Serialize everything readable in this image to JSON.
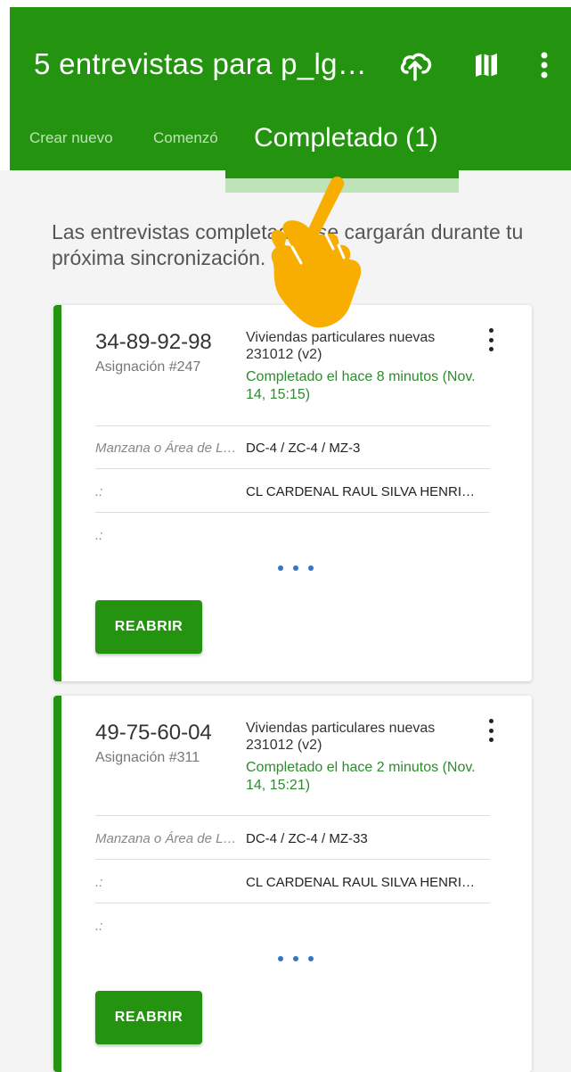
{
  "app_bar": {
    "title": "5 entrevistas para p_lg…",
    "icons": [
      "cloud-sync-icon",
      "map-icon",
      "more-vert-icon"
    ],
    "color": "#24930f"
  },
  "tabs": [
    {
      "label": "Crear nuevo",
      "active": false
    },
    {
      "label": "Comenzó",
      "active": false
    },
    {
      "label": "Completado (1)",
      "active": true
    }
  ],
  "info_text": "Las entrevistas completadas se cargarán durante tu próxima sincronización.",
  "cards": [
    {
      "id": "34-89-92-98",
      "assignment": "Asignación #247",
      "survey": "Viviendas particulares nuevas 231012 (v2)",
      "status": "Completado el hace 8 minutos (Nov. 14, 15:15)",
      "fields": [
        {
          "label": "Manzana o Área de L…",
          "value": "DC-4 / ZC-4 / MZ-3"
        },
        {
          "label": ".:",
          "value": "CL CARDENAL RAUL SILVA HENRI…"
        },
        {
          "label": ".:",
          "value": ""
        }
      ],
      "action": "REABRIR"
    },
    {
      "id": "49-75-60-04",
      "assignment": "Asignación #311",
      "survey": "Viviendas particulares nuevas 231012 (v2)",
      "status": "Completado el hace 2 minutos (Nov. 14, 15:21)",
      "fields": [
        {
          "label": "Manzana o Área de L…",
          "value": "DC-4 / ZC-4 / MZ-33"
        },
        {
          "label": ".:",
          "value": "CL CARDENAL RAUL SILVA HENRI…"
        },
        {
          "label": ".:",
          "value": ""
        }
      ],
      "action": "REABRIR"
    }
  ],
  "overlay": {
    "icon": "pointing-hand-icon",
    "color": "#f7ae00"
  }
}
